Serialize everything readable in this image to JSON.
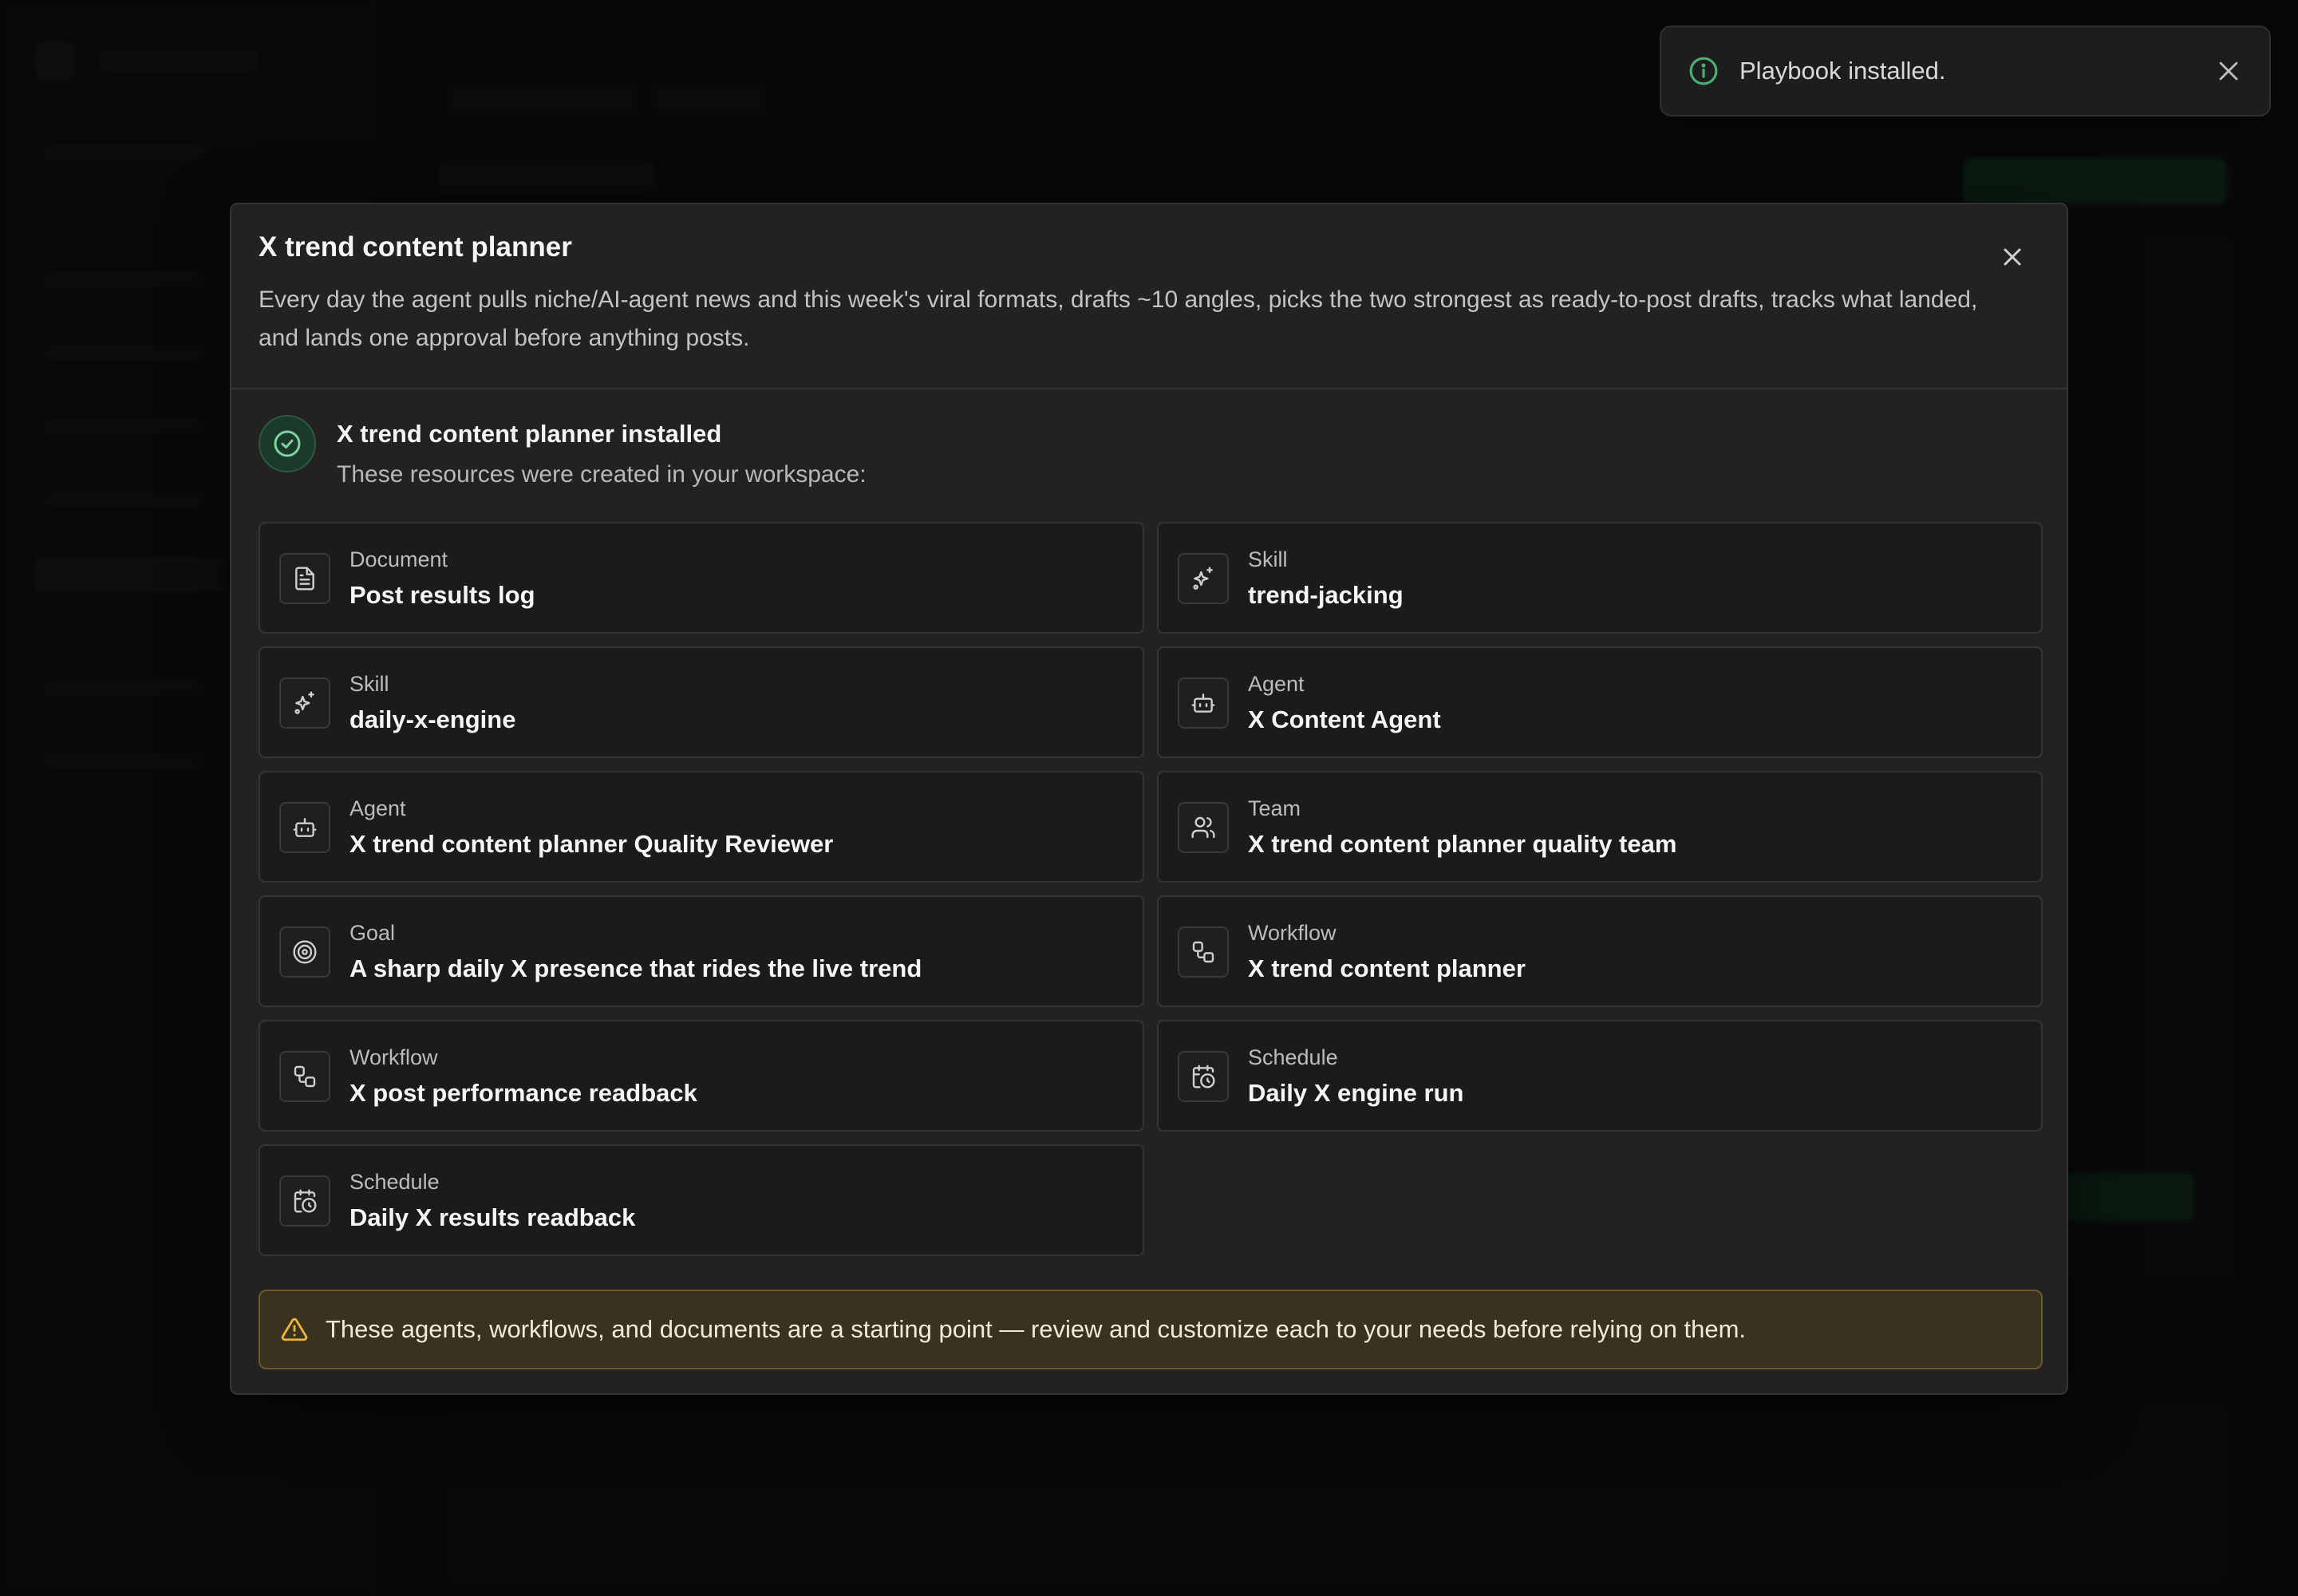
{
  "toast": {
    "message": "Playbook installed.",
    "icon": "info-icon",
    "accent": "#4caf72"
  },
  "modal": {
    "title": "X trend content planner",
    "description": "Every day the agent pulls niche/AI-agent news and this week's viral formats, drafts ~10 angles, picks the two strongest as ready-to-post drafts, tracks what landed, and lands one approval before anything posts.",
    "installed": {
      "title": "X trend content planner installed",
      "subtitle": "These resources were created in your workspace:"
    },
    "resources": [
      {
        "type": "Document",
        "name": "Post results log",
        "icon": "document-icon"
      },
      {
        "type": "Skill",
        "name": "trend-jacking",
        "icon": "sparkle-icon"
      },
      {
        "type": "Skill",
        "name": "daily-x-engine",
        "icon": "sparkle-icon"
      },
      {
        "type": "Agent",
        "name": "X Content Agent",
        "icon": "bot-icon"
      },
      {
        "type": "Agent",
        "name": "X trend content planner Quality Reviewer",
        "icon": "bot-icon"
      },
      {
        "type": "Team",
        "name": "X trend content planner quality team",
        "icon": "users-icon"
      },
      {
        "type": "Goal",
        "name": "A sharp daily X presence that rides the live trend",
        "icon": "target-icon"
      },
      {
        "type": "Workflow",
        "name": "X trend content planner",
        "icon": "workflow-icon"
      },
      {
        "type": "Workflow",
        "name": "X post performance readback",
        "icon": "workflow-icon"
      },
      {
        "type": "Schedule",
        "name": "Daily X engine run",
        "icon": "calendar-clock-icon"
      },
      {
        "type": "Schedule",
        "name": "Daily X results readback",
        "icon": "calendar-clock-icon"
      }
    ],
    "warning": "These agents, workflows, and documents are a starting point — review and customize each to your needs before relying on them."
  },
  "colors": {
    "success": "#4caf72",
    "warning": "#e8b53a"
  }
}
